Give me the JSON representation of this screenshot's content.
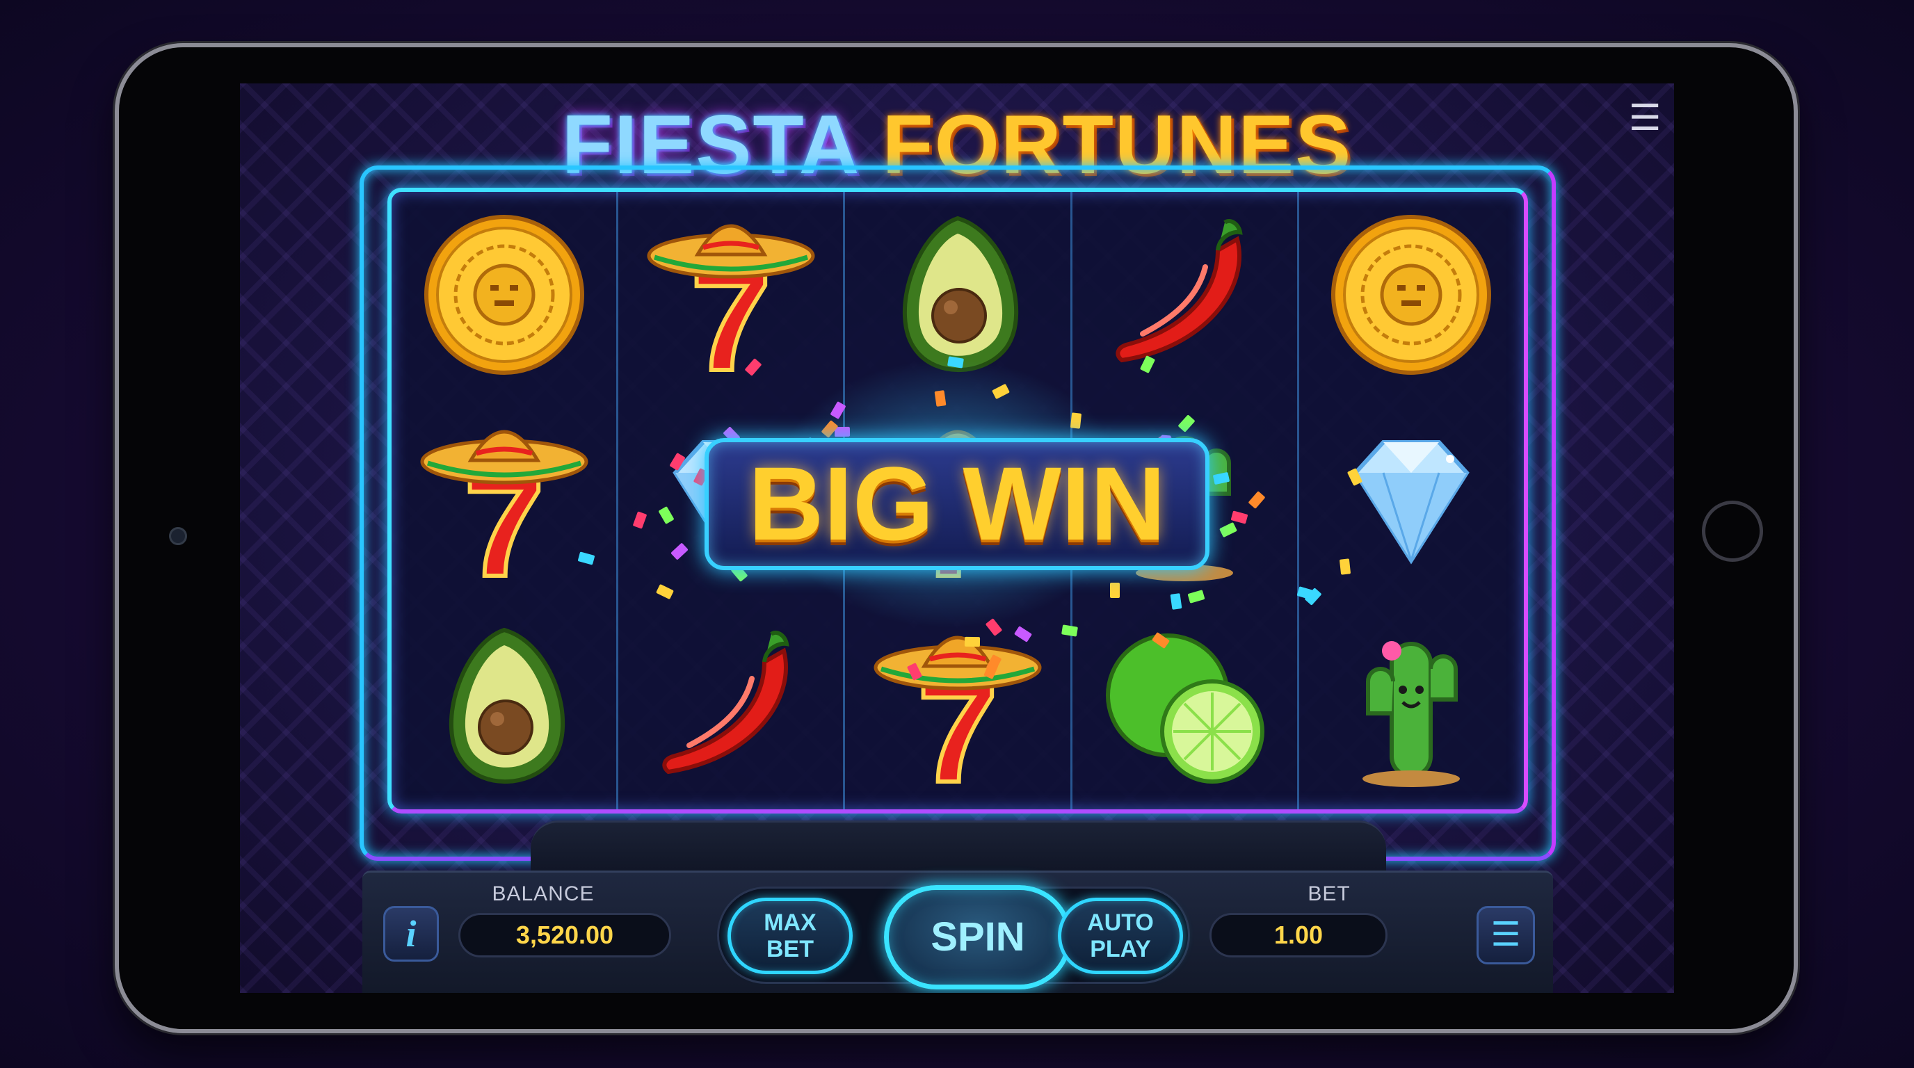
{
  "game": {
    "title_part1": "FIESTA",
    "title_part2": "FORTUNES",
    "win_banner": "BIG WIN"
  },
  "reels": [
    [
      "aztec-coin",
      "sombrero-seven",
      "avocado"
    ],
    [
      "sombrero-seven",
      "diamond",
      "chili-pepper"
    ],
    [
      "avocado",
      "sombrero-seven",
      "sombrero-seven"
    ],
    [
      "chili-pepper",
      "cactus",
      "lime"
    ],
    [
      "aztec-coin",
      "diamond",
      "cactus"
    ]
  ],
  "controls": {
    "info_label": "i",
    "balance_label": "BALANCE",
    "balance_value": "3,520.00",
    "max_bet_line1": "MAX",
    "max_bet_line2": "BET",
    "spin_label": "SPIN",
    "auto_play_line1": "AUTO",
    "auto_play_line2": "PLAY",
    "bet_label": "BET",
    "bet_value": "1.00",
    "menu_icon": "hamburger-icon"
  },
  "top_menu_icon": "hamburger-icon",
  "colors": {
    "neon_cyan": "#29c6ff",
    "neon_purple": "#c23cff",
    "gold": "#ffc72e",
    "background": "#170b33"
  }
}
